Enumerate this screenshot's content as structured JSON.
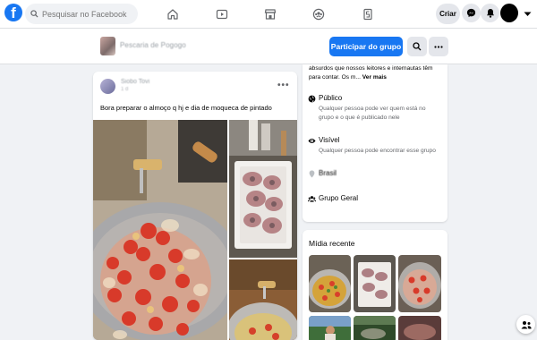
{
  "topbar": {
    "logo_letter": "f",
    "search_placeholder": "Pesquisar no Facebook",
    "nav_icons": [
      "home-icon",
      "watch-icon",
      "marketplace-icon",
      "groups-icon",
      "gaming-icon"
    ],
    "create_label": "Criar",
    "right_icons": [
      "messenger-icon",
      "notifications-icon",
      "account-avatar",
      "menu-caret-icon"
    ]
  },
  "group": {
    "name": "Pescaria de Pogogo",
    "join_label": "Participar do grupo",
    "search_icon": "search-icon",
    "more_icon": "more-icon",
    "accent": "#1877f2"
  },
  "post": {
    "author": "Siobo Tovi",
    "date": "1 d",
    "more_label": "•••",
    "text": "Bora preparar o almoço q hj e dia de moqueca de pintado"
  },
  "about": {
    "desc_line1": "absurdos que nossos leitores e internautas têm",
    "desc_line2": "para contar. Os m...",
    "see_more": "Ver mais",
    "public_title": "Público",
    "public_desc": "Qualquer pessoa pode ver quem está no grupo e o que é publicado nele",
    "visible_title": "Visível",
    "visible_desc": "Qualquer pessoa pode encontrar esse grupo",
    "location_label": "Brasil",
    "general_title": "Grupo Geral"
  },
  "media": {
    "title": "Mídia recente"
  }
}
